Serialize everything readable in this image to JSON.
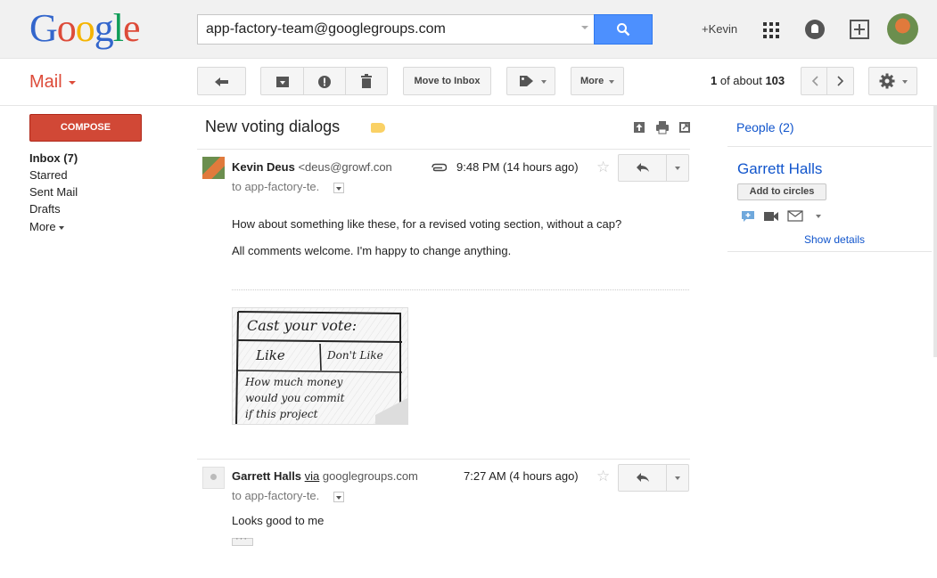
{
  "header": {
    "logo_letters": [
      {
        "ch": "G",
        "color": "#3366cc"
      },
      {
        "ch": "o",
        "color": "#dd4b39"
      },
      {
        "ch": "o",
        "color": "#f5b400"
      },
      {
        "ch": "g",
        "color": "#3366cc"
      },
      {
        "ch": "l",
        "color": "#0f9d58"
      },
      {
        "ch": "e",
        "color": "#dd4b39"
      }
    ],
    "search_value": "app-factory-team@googlegroups.com",
    "plus_user": "+Kevin",
    "icons": [
      "search-icon",
      "apps-icon",
      "notifications-icon",
      "share-icon",
      "avatar"
    ]
  },
  "toolbar": {
    "app_label": "Mail",
    "move_to_inbox": "Move to Inbox",
    "more": "More",
    "page_count_prefix": "1",
    "page_count_mid": " of about ",
    "page_count_total": "103"
  },
  "nav": {
    "compose": "COMPOSE",
    "items": [
      "Inbox (7)",
      "Starred",
      "Sent Mail",
      "Drafts",
      "More"
    ]
  },
  "thread": {
    "subject": "New voting dialogs",
    "label_color": "#fad165",
    "messages": [
      {
        "sender_name": "Kevin Deus",
        "sender_email": "<deus@growf.con",
        "to": "to app-factory-te.",
        "time": "9:48 PM (14 hours ago)",
        "has_attachment": true,
        "body": [
          "How about something like these, for a revised voting section, without a cap?",
          "All comments welcome. I'm happy to change anything."
        ],
        "attachment_sketch": {
          "line1": "Cast your vote:",
          "like": "Like",
          "dislike": "Don't Like",
          "line3": "How much money",
          "line4": "would you commit",
          "line5": "if this project"
        }
      },
      {
        "sender_name": "Garrett Halls",
        "via_label": "via",
        "via_domain": "googlegroups.com",
        "to": "to app-factory-te.",
        "time": "7:27 AM (4 hours ago)",
        "body": [
          "Looks good to me"
        ]
      }
    ]
  },
  "people": {
    "title": "People (2)",
    "name": "Garrett Halls",
    "add_to_circles": "Add to circles",
    "show_details": "Show details"
  }
}
